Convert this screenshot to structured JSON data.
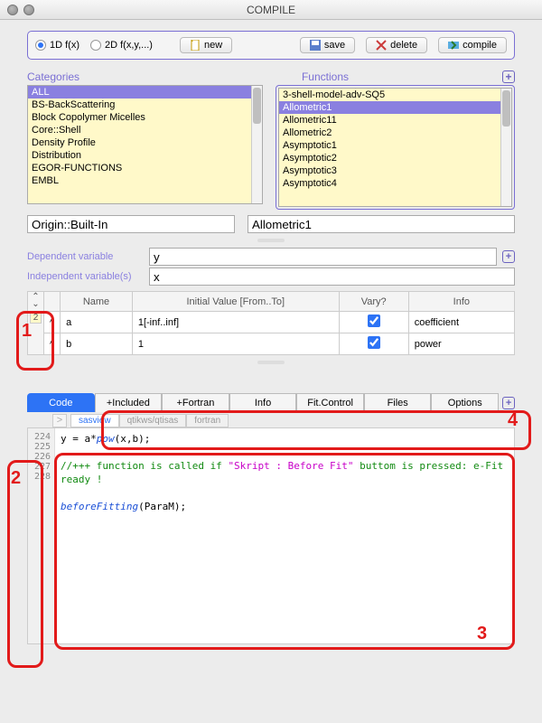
{
  "window": {
    "title": "COMPILE"
  },
  "toprow": {
    "radio1": "1D f(x)",
    "radio2": "2D f(x,y,...)",
    "new": "new",
    "save": "save",
    "delete": "delete",
    "compile": "compile"
  },
  "categories": {
    "header": "Categories",
    "items": [
      "ALL",
      "BS-BackScattering",
      "Block Copolymer Micelles",
      "Core::Shell",
      "Density Profile",
      "Distribution",
      "EGOR-FUNCTIONS",
      "EMBL"
    ]
  },
  "functions": {
    "header": "Functions",
    "items": [
      "3-shell-model-adv-SQ5",
      "Allometric1",
      "Allometric11",
      "Allometric2",
      "Asymptotic1",
      "Asymptotic2",
      "Asymptotic3",
      "Asymptotic4"
    ]
  },
  "origin": {
    "value": "Origin::Built-In"
  },
  "selected": {
    "value": "Allometric1"
  },
  "depvar": {
    "label": "Dependent variable",
    "value": "y"
  },
  "indepvar": {
    "label": "Independent variable(s)",
    "value": "x"
  },
  "paramCount": "2",
  "paramTable": {
    "headers": {
      "name": "Name",
      "init": "Initial Value [From..To]",
      "vary": "Vary?",
      "info": "Info"
    },
    "rows": [
      {
        "name": "a",
        "init": "1[-inf..inf]",
        "vary": true,
        "info": "coefficient"
      },
      {
        "name": "b",
        "init": "1",
        "vary": true,
        "info": "power"
      }
    ]
  },
  "edtabs": {
    "code": "Code",
    "included": "+Included",
    "fortran": "+Fortran",
    "info": "Info",
    "fitcontrol": "Fit.Control",
    "files": "Files",
    "options": "Options"
  },
  "subtabs": {
    "go": ">",
    "t1": "sasview",
    "t2": "qtikws/qtisas",
    "t3": "fortran"
  },
  "gutter": [
    "224",
    "225",
    "226",
    "227",
    "228"
  ],
  "codeText": {
    "l1a": "y = a*",
    "l1b": "pow",
    "l1c": "(x,b);",
    "l2a": "//+++ function is called  if ",
    "l2b": "\"Skript : Before Fit\"",
    "l2c": " buttom is pressed:  e-Fit ready !",
    "l3a": "beforeFitting",
    "l3b": "(ParaM);"
  },
  "ann": {
    "n1": "1",
    "n2": "2",
    "n3": "3",
    "n4": "4"
  }
}
